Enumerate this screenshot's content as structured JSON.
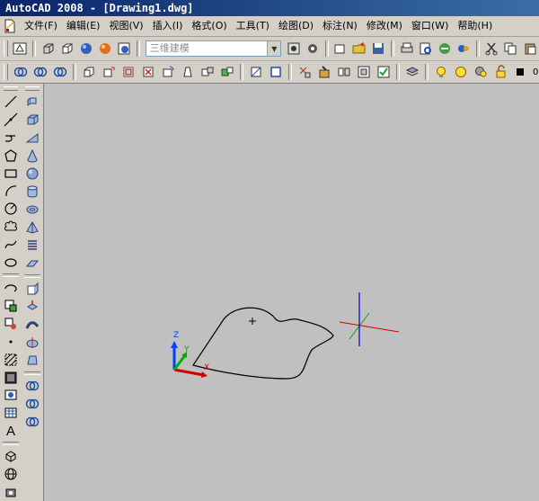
{
  "window": {
    "title": "AutoCAD 2008 - [Drawing1.dwg]"
  },
  "menu": {
    "items": [
      "文件(F)",
      "编辑(E)",
      "视图(V)",
      "插入(I)",
      "格式(O)",
      "工具(T)",
      "绘图(D)",
      "标注(N)",
      "修改(M)",
      "窗口(W)",
      "帮助(H)"
    ]
  },
  "toolbar": {
    "workspace_combo": {
      "value": "三维建模"
    },
    "layer_label": "0"
  },
  "left_toolbar": {
    "text_tool_label": "A"
  },
  "canvas": {
    "ucs_axis_labels": {
      "x": "X",
      "y": "Y",
      "z": "Z"
    },
    "colors": {
      "background": "#c0c0c0",
      "x_axis": "#cc0000",
      "y_axis": "#00aa00",
      "z_axis": "#0000cc",
      "curve": "#000000"
    }
  }
}
